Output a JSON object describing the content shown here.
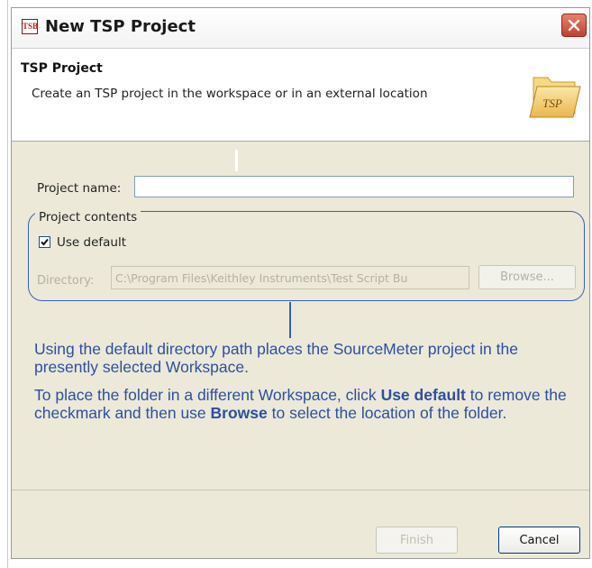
{
  "window": {
    "app_icon_text": "TSB",
    "title": "New TSP Project"
  },
  "header": {
    "section_title": "TSP Project",
    "description": "Create an TSP project in the workspace or in an external location",
    "folder_label": "TSP"
  },
  "form": {
    "project_name_label": "Project name:",
    "project_name_value": "",
    "group_label": "Project contents",
    "use_default_label": "Use default",
    "use_default_checked": true,
    "directory_label": "Directory:",
    "directory_value": "C:\\Program Files\\Keithley Instruments\\Test Script Bu",
    "browse_label": "Browse..."
  },
  "callout": {
    "para1": "Using the default directory path places the SourceMeter project in the presently selected Workspace.",
    "para2_before": "To place the folder in a different Workspace, click ",
    "para2_bold1": "Use default",
    "para2_middle": " to remove the checkmark and then use ",
    "para2_bold2": "Browse",
    "para2_after": " to select the location of the folder."
  },
  "buttons": {
    "finish_label": "Finish",
    "cancel_label": "Cancel"
  },
  "colors": {
    "callout_text": "#2d4fa3",
    "dialog_bg": "#ece9d8",
    "close_button": "#c4412a"
  }
}
